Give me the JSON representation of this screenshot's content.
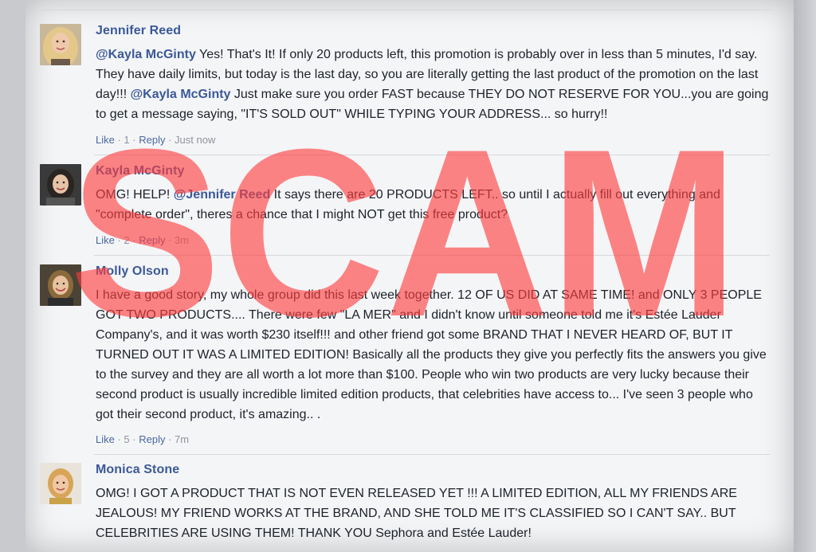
{
  "colors": {
    "name": "#3b5998",
    "text": "#1d2129",
    "meta": "#90949c",
    "watermark": "#ff3b3b"
  },
  "watermark_text": "SCAM",
  "comments": [
    {
      "name": "Jennifer Reed",
      "avatar_icon": "avatar-blonde-woman",
      "p1_mention": "@Kayla McGinty",
      "p1_text": " Yes! That's It! If only 20 products left, this promotion is probably over in less than 5 minutes, I'd say. They have daily limits, but today is the last day, so you are literally getting the last product of the promotion on the last day!!! ",
      "p2_mention": "@Kayla McGinty",
      "p2_text": " Just make sure you order FAST because THEY DO NOT RESERVE FOR YOU...you are going to get a message saying, \"IT'S SOLD OUT\" WHILE TYPING YOUR ADDRESS... so hurry!!",
      "like": "Like",
      "count": "1",
      "reply": "Reply",
      "time": "Just now"
    },
    {
      "name": "Kayla McGinty",
      "avatar_icon": "avatar-dark-hair-woman",
      "p0_text": "OMG! HELP! ",
      "p1_mention": "@Jennifer Reed",
      "p1_text": " It says there are 20 PRODUCTS LEFT.. so until I actually fill out everything and \"complete order\", theres a chance that I might NOT get this free product?",
      "like": "Like",
      "count": "2",
      "reply": "Reply",
      "time": "3m"
    },
    {
      "name": "Molly Olson",
      "avatar_icon": "avatar-smiling-woman",
      "text": "I have a good story, my whole group did this last week together. 12 OF US DID AT SAME TIME! and ONLY 3 PEOPLE GOT TWO PRODUCTS.... There were few \"LA MER\" and I didn't know until someone told me it's Estée Lauder Company's, and it was worth $230 itself!!! and other friend got some BRAND THAT I NEVER HEARD OF, BUT IT TURNED OUT IT WAS A LIMITED EDITION! Basically all the products they give you perfectly fits the answers you give to the survey and they are all worth a lot more than $100. People who win two products are very lucky because their second product is usually incredible limited edition products, that celebrities have access to... I've seen 3 people who got their second product, it's amazing.. .",
      "like": "Like",
      "count": "5",
      "reply": "Reply",
      "time": "7m"
    },
    {
      "name": "Monica Stone",
      "avatar_icon": "avatar-blonde-woman-2",
      "text": "OMG! I GOT A PRODUCT THAT IS NOT EVEN RELEASED YET !!! A LIMITED EDITION, ALL MY FRIENDS ARE JEALOUS! MY FRIEND WORKS AT THE BRAND, AND SHE TOLD ME IT'S CLASSIFIED SO I CAN'T SAY.. BUT CELEBRITIES ARE USING THEM! THANK YOU Sephora and Estée Lauder!"
    }
  ]
}
